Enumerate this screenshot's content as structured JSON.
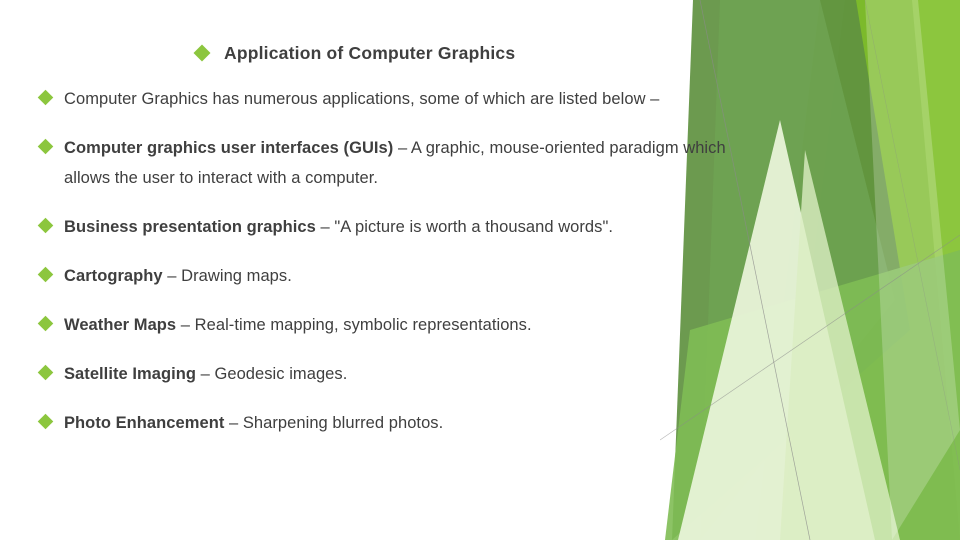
{
  "slide": {
    "title": {
      "bullet_icon": "green-diamond-bullet",
      "text": "Application of Computer Graphics"
    },
    "bullets": [
      {
        "bullet_icon": "green-diamond-bullet",
        "lead": "",
        "rest": "Computer Graphics has numerous applications, some of which are listed below –"
      },
      {
        "bullet_icon": "green-diamond-bullet",
        "lead": "Computer graphics user interfaces (GUIs)",
        "rest": " – A graphic, mouse-oriented paradigm which allows the user to interact with a computer."
      },
      {
        "bullet_icon": "green-diamond-bullet",
        "lead": "Business presentation graphics",
        "rest": " – \"A picture is worth a thousand words\"."
      },
      {
        "bullet_icon": "green-diamond-bullet",
        "lead": "Cartography",
        "rest": " – Drawing maps."
      },
      {
        "bullet_icon": "green-diamond-bullet",
        "lead": "Weather Maps",
        "rest": " – Real-time mapping, symbolic representations."
      },
      {
        "bullet_icon": "green-diamond-bullet",
        "lead": "Satellite Imaging",
        "rest": " – Geodesic images."
      },
      {
        "bullet_icon": "green-diamond-bullet",
        "lead": "Photo Enhancement",
        "rest": " – Sharpening blurred photos."
      }
    ],
    "colors": {
      "bullet_green": "#8cc63e",
      "text_gray": "#3f3f3f",
      "decor_lime": "#8cc63e",
      "decor_bright_green": "#7ab829",
      "decor_sage": "#6ea352",
      "decor_dark_sage": "#5f9140",
      "decor_pale": "#dbeec2",
      "decor_pale_light": "#e8f3d8",
      "decor_mid": "#7fbc54",
      "background": "#ffffff"
    }
  }
}
